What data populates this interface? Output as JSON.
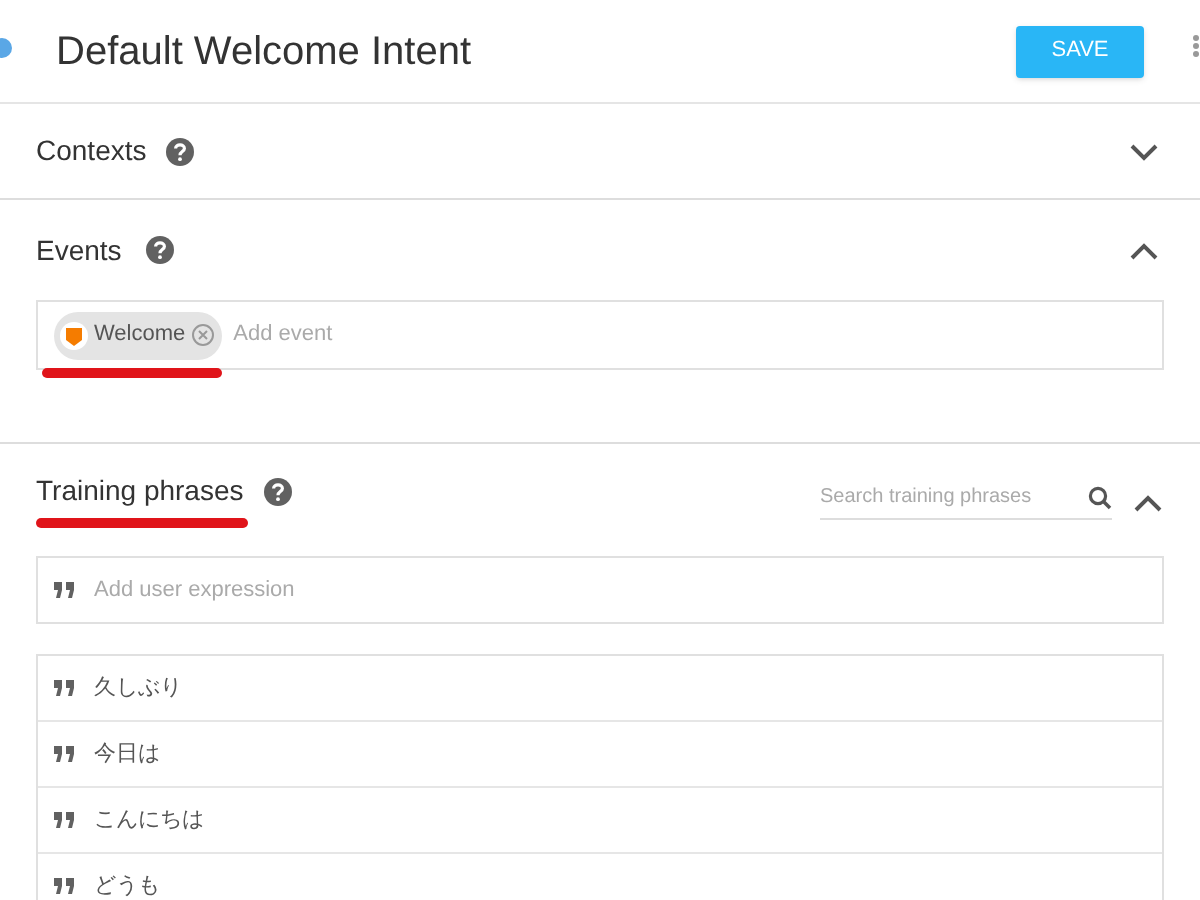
{
  "header": {
    "title": "Default Welcome Intent",
    "save_button": "SAVE"
  },
  "contexts": {
    "title": "Contexts",
    "expanded": false
  },
  "events": {
    "title": "Events",
    "expanded": true,
    "chips": [
      {
        "label": "Welcome"
      }
    ],
    "placeholder": "Add event"
  },
  "training_phrases": {
    "title": "Training phrases",
    "expanded": true,
    "search_placeholder": "Search training phrases",
    "add_placeholder": "Add user expression",
    "phrases": [
      "久しぶり",
      "今日は",
      "こんにちは",
      "どうも"
    ]
  }
}
